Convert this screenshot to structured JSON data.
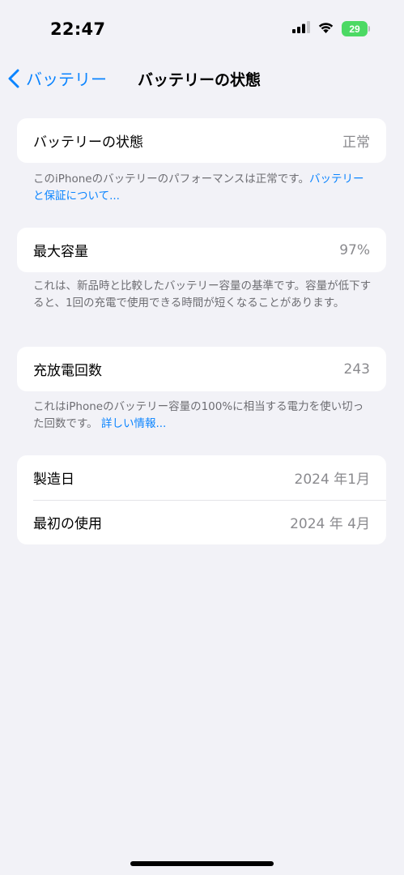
{
  "status": {
    "time": "22:47",
    "battery_level": "29",
    "signal_icon": "cellular-signal-icon",
    "wifi_icon": "wifi-icon",
    "battery_color": "#4cd964"
  },
  "nav": {
    "back_label": "バッテリー",
    "title": "バッテリーの状態"
  },
  "health": {
    "label": "バッテリーの状態",
    "value": "正常",
    "note": "このiPhoneのバッテリーのパフォーマンスは正常です。",
    "note_link": "バッテリーと保証について..."
  },
  "capacity": {
    "label": "最大容量",
    "value": "97%",
    "note": "これは、新品時と比較したバッテリー容量の基準です。容量が低下すると、1回の充電で使用できる時間が短くなることがあります。"
  },
  "cycles": {
    "label": "充放電回数",
    "value": "243",
    "note": "これはiPhoneのバッテリー容量の100%に相当する電力を使い切った回数です。",
    "note_link": "詳しい情報..."
  },
  "dates": {
    "manufacture_label": "製造日",
    "manufacture_value": "2024 年1月",
    "first_use_label": "最初の使用",
    "first_use_value": "2024 年 4月"
  },
  "colors": {
    "accent": "#0a84ff",
    "background": "#f2f2f7",
    "secondary_text": "#8a8a8e"
  }
}
